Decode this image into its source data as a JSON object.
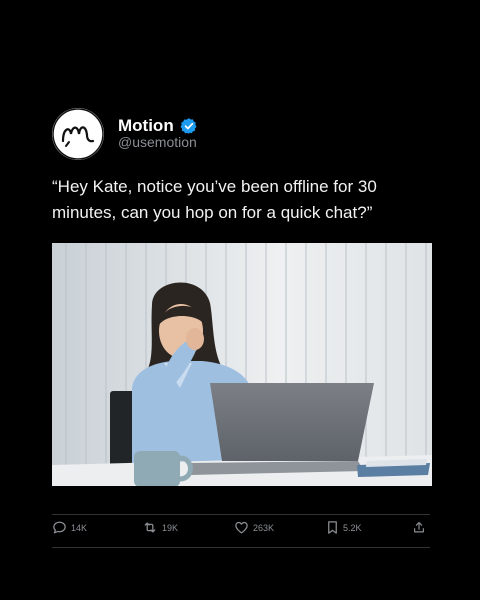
{
  "account": {
    "name": "Motion",
    "handle": "@usemotion",
    "verified": true,
    "verified_color": "#1d9bf0"
  },
  "tweet": {
    "text": "“Hey Kate, notice you’ve been offline for 30 minutes, can you hop on for a quick chat?”"
  },
  "media": {
    "icon": "photo"
  },
  "actions": {
    "replies": "14K",
    "retweets": "19K",
    "likes": "263K",
    "bookmarks": "5.2K"
  },
  "colors": {
    "background": "#000000",
    "text": "#f2f2f2",
    "muted": "#8b8f94"
  }
}
